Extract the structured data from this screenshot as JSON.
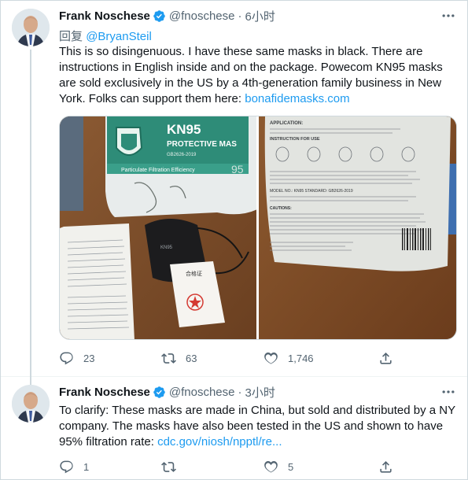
{
  "tweets": [
    {
      "author": {
        "name": "Frank Noschese",
        "handle": "@fnoschese",
        "verified": true
      },
      "time": "6小时",
      "reply_prefix": "回复",
      "reply_mention": "@BryanSteil",
      "text_lines": [
        "This is so disingenuous. I have these same masks in black. There are",
        "instructions in English inside and on the package. Powecom KN95 masks",
        "are sold exclusively in the US by a 4th-generation family business in New",
        "York. Folks can support them here: "
      ],
      "link": "bonafidemasks.com",
      "media": {
        "left_photo": {
          "package_title": "KN95",
          "package_subtitle": "PROTECTIVE MAS",
          "package_standard": "GB2626-2019",
          "package_band": "Particulate Filtration Efficiency",
          "package_number": "95",
          "mask_text": "KN95",
          "card_title": "合格证"
        },
        "right_photo": {
          "heading": "APPLICATION:",
          "instruction_title": "INSTRUCTION FOR USE",
          "model_row": "MODEL NO.: KN95        STANDARD: GB2626-2019",
          "caution": "CAUTIONS:"
        }
      },
      "stats": {
        "replies": "23",
        "retweets": "63",
        "likes": "1,746"
      }
    },
    {
      "author": {
        "name": "Frank Noschese",
        "handle": "@fnoschese",
        "verified": true
      },
      "time": "3小时",
      "text_lines": [
        "To clarify: These masks are made in China, but sold and distributed by a NY",
        "company. The masks have also been tested in the US and shown to have",
        "95% filtration rate: "
      ],
      "link": "cdc.gov/niosh/npptl/re...",
      "stats": {
        "replies": "1",
        "retweets": "",
        "likes": "5"
      }
    }
  ],
  "colors": {
    "accent": "#1d9bf0",
    "secondary_text": "#536471",
    "primary_text": "#0f1419",
    "divider": "#eff3f4"
  },
  "icons": [
    "verified-badge-icon",
    "more-icon",
    "reply-icon",
    "retweet-icon",
    "like-icon",
    "share-icon"
  ]
}
